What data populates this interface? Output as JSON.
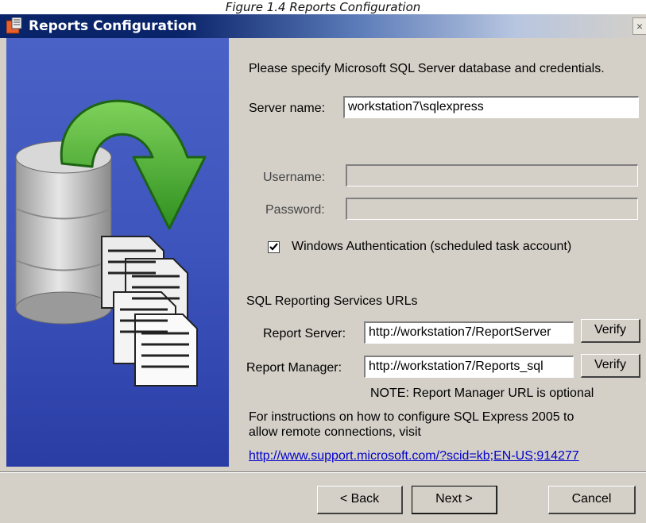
{
  "caption": "Figure 1.4 Reports Configuration",
  "window": {
    "title": "Reports Configuration",
    "close_glyph": "×"
  },
  "form": {
    "intro": "Please specify Microsoft SQL Server database and credentials.",
    "server_name_label": "Server name:",
    "server_name_value": "workstation7\\sqlexpress",
    "username_label": "Username:",
    "username_value": "",
    "password_label": "Password:",
    "password_value": "",
    "windows_auth_label": "Windows Authentication (scheduled task account)",
    "windows_auth_checked": true,
    "ssrs_heading": "SQL Reporting Services URLs",
    "report_server_label": "Report Server:",
    "report_server_value": "http://workstation7/ReportServer",
    "report_manager_label": "Report Manager:",
    "report_manager_value": "http://workstation7/Reports_sql",
    "verify_label": "Verify",
    "note": "NOTE: Report Manager URL is optional",
    "instructions_line1": "For instructions on how to configure SQL Express 2005 to",
    "instructions_line2": "allow remote connections, visit",
    "link": "http://www.support.microsoft.com/?scid=kb;EN-US;914277"
  },
  "footer": {
    "back_label": "< Back",
    "next_label": "Next >",
    "cancel_label": "Cancel"
  },
  "icons": {
    "title": "reports-app-icon",
    "side": "database-to-documents-icon",
    "check": "checkmark-icon"
  },
  "colors": {
    "title_bar": "#0a246a",
    "side_panel": "#3d54bd",
    "arrow_green": "#3fa52a",
    "dialog_face": "#d4d0c8",
    "link": "#0000cc"
  }
}
